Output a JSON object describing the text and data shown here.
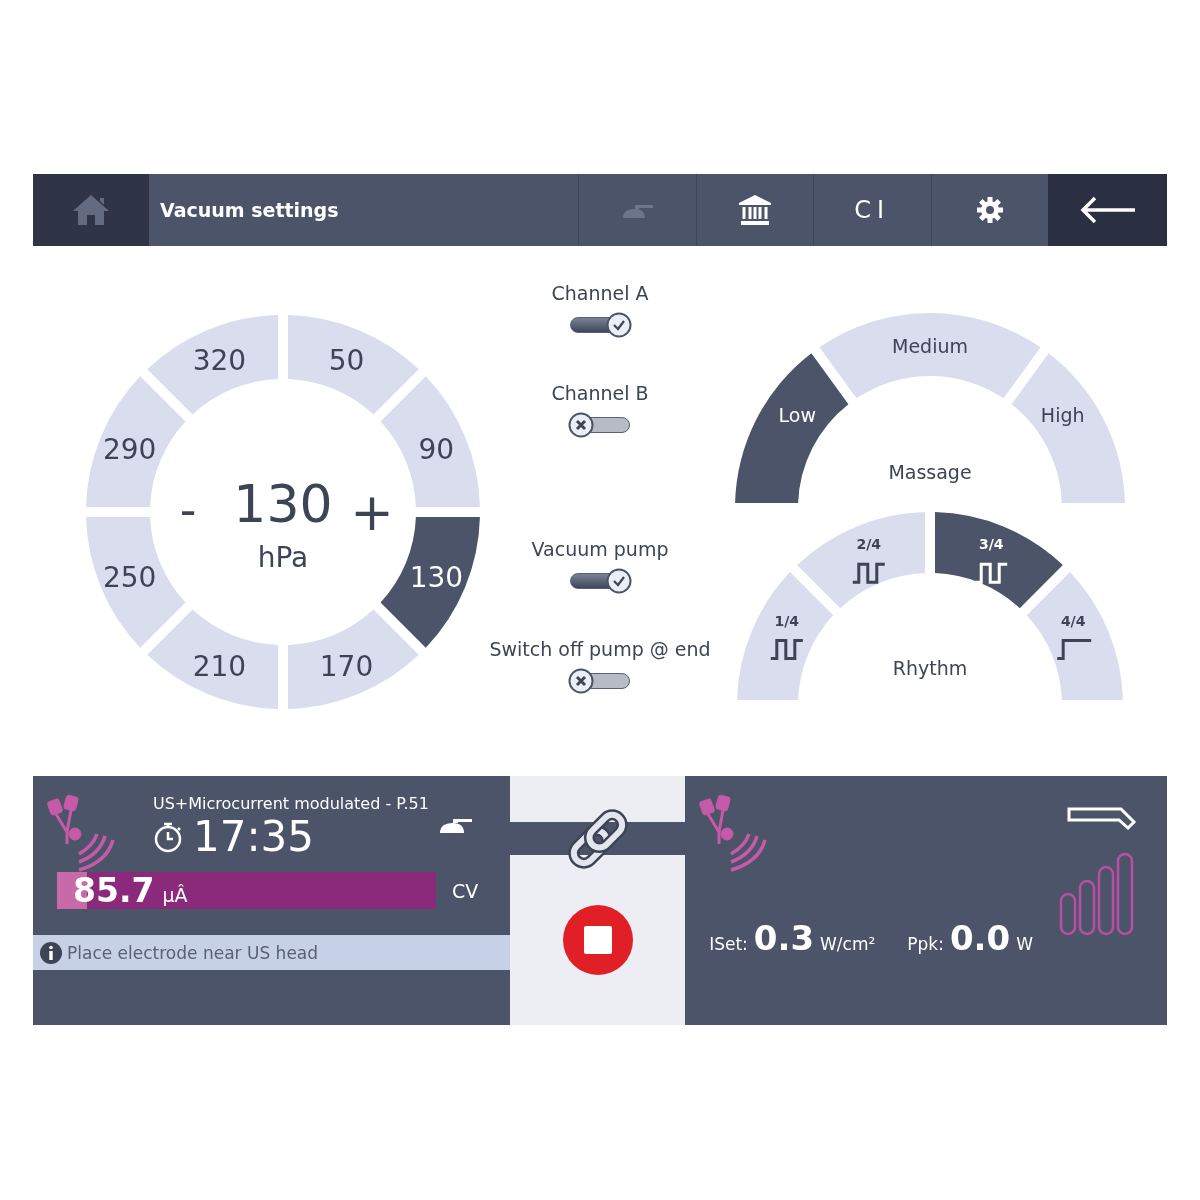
{
  "top_bar": {
    "title": "Vacuum settings",
    "tools": [
      {
        "kind": "applicator",
        "disabled": true
      },
      {
        "kind": "museum",
        "disabled": false
      },
      {
        "kind": "text",
        "label": "CI",
        "disabled": false
      },
      {
        "kind": "settings",
        "disabled": false
      }
    ]
  },
  "pressure": {
    "minus": "-",
    "value": "130",
    "plus": "+",
    "unit": "hPa",
    "presets": [
      {
        "label": "50",
        "selected": false
      },
      {
        "label": "90",
        "selected": false
      },
      {
        "label": "130",
        "selected": true
      },
      {
        "label": "170",
        "selected": false
      },
      {
        "label": "210",
        "selected": false
      },
      {
        "label": "250",
        "selected": false
      },
      {
        "label": "290",
        "selected": false
      },
      {
        "label": "320",
        "selected": false
      }
    ]
  },
  "switches": [
    {
      "label": "Channel A",
      "on": true
    },
    {
      "label": "Channel B",
      "on": false
    },
    {
      "label": "Vacuum pump",
      "on": true
    },
    {
      "label": "Switch off pump @ end",
      "on": false
    }
  ],
  "massage": {
    "title": "Massage",
    "levels": [
      {
        "label": "Low",
        "selected": true
      },
      {
        "label": "Medium",
        "selected": false
      },
      {
        "label": "High",
        "selected": false
      }
    ]
  },
  "rhythm": {
    "title": "Rhythm",
    "options": [
      {
        "label": "1/4",
        "kind": "pulse",
        "selected": false
      },
      {
        "label": "2/4",
        "kind": "pulse",
        "selected": false
      },
      {
        "label": "3/4",
        "kind": "pulse",
        "selected": true
      },
      {
        "label": "4/4",
        "kind": "step",
        "selected": false
      }
    ]
  },
  "channel_a": {
    "program": "US+Microcurrent modulated - P.51",
    "timer": "17:35",
    "reading": "85.7",
    "unit": "μÂ",
    "level": 0.08,
    "mode": "CV",
    "info": "Place electrode near US head"
  },
  "channel_b": {
    "iset_label": "ISet:",
    "iset_value": "0.3",
    "iset_unit": "W/cm²",
    "ppk_label": "Ppk:",
    "ppk_value": "0.0",
    "ppk_unit": "W"
  }
}
